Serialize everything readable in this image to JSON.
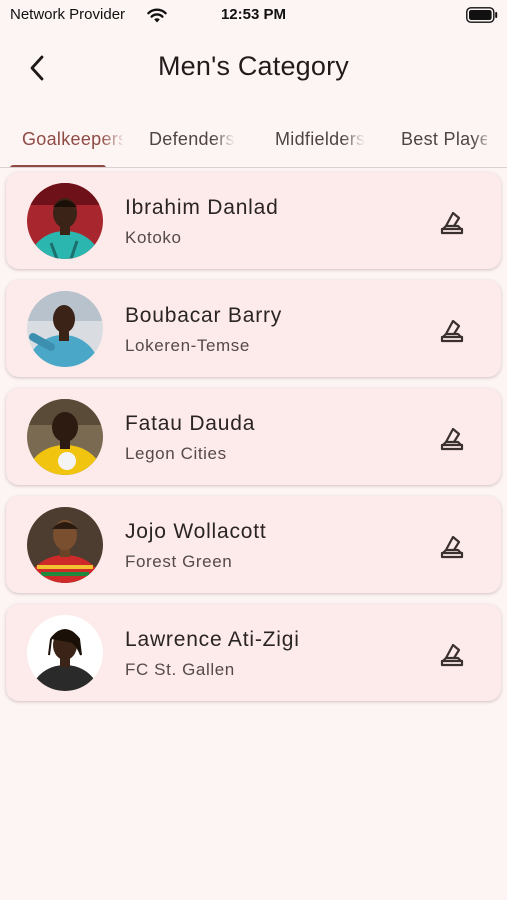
{
  "status_bar": {
    "carrier": "Network Provider",
    "time": "12:53 PM",
    "wifi_icon": "wifi-icon",
    "battery_icon": "battery-icon"
  },
  "app_bar": {
    "title": "Men's Category",
    "back_icon": "chevron-left-icon"
  },
  "tabs": [
    {
      "label": "Goalkeepers",
      "active": true
    },
    {
      "label": "Defenders",
      "active": false
    },
    {
      "label": "Midfielders",
      "active": false
    },
    {
      "label": "Best Player",
      "active": false
    }
  ],
  "players": [
    {
      "name": "Ibrahim Danlad",
      "club": "Kotoko",
      "vote_icon": "ballot-box-icon"
    },
    {
      "name": "Boubacar Barry",
      "club": "Lokeren-Temse",
      "vote_icon": "ballot-box-icon"
    },
    {
      "name": "Fatau Dauda",
      "club": "Legon Cities",
      "vote_icon": "ballot-box-icon"
    },
    {
      "name": "Jojo Wollacott",
      "club": "Forest Green",
      "vote_icon": "ballot-box-icon"
    },
    {
      "name": "Lawrence Ati-Zigi",
      "club": "FC St. Gallen",
      "vote_icon": "ballot-box-icon"
    }
  ],
  "colors": {
    "background": "#fdf5f4",
    "card": "#fcebea",
    "accent": "#8e4a44",
    "text": "#2b2424"
  }
}
